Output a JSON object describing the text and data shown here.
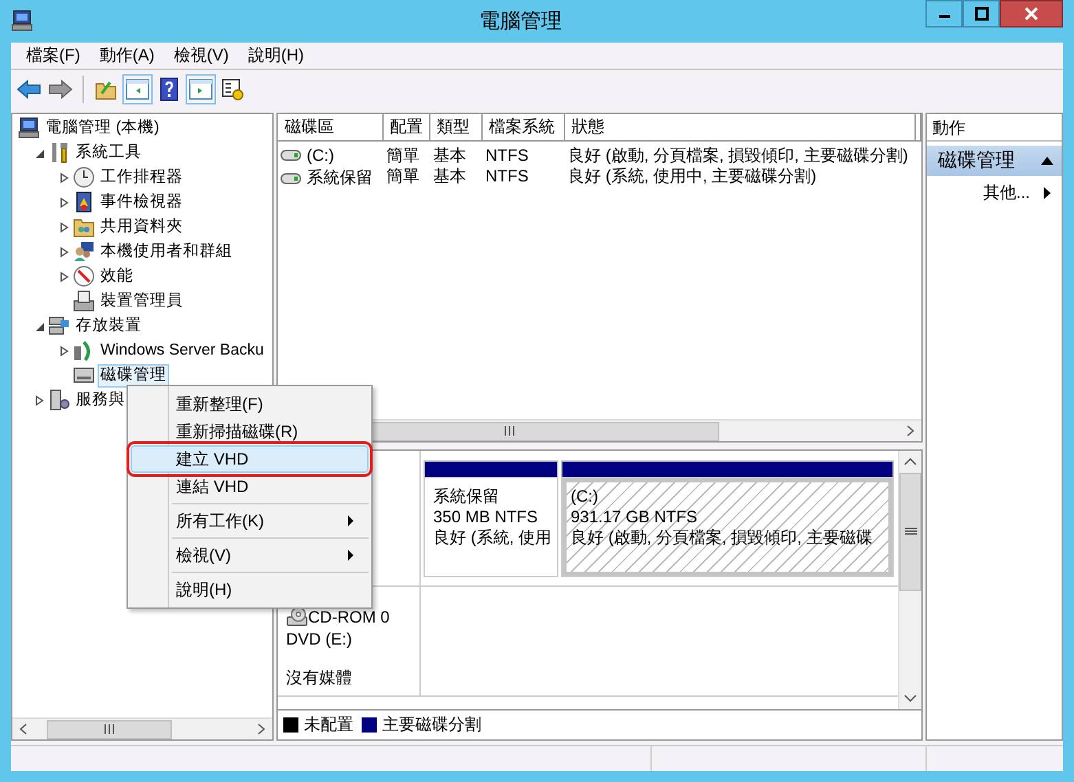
{
  "window": {
    "title": "電腦管理"
  },
  "menu_bar": [
    "檔案(F)",
    "動作(A)",
    "檢視(V)",
    "說明(H)"
  ],
  "tree": [
    {
      "label": "電腦管理 (本機)",
      "selected": false,
      "children": [
        {
          "label": "系統工具",
          "expanded": true,
          "selected": false,
          "children": [
            {
              "label": "工作排程器",
              "expanded": false,
              "selected": false
            },
            {
              "label": "事件檢視器",
              "expanded": false,
              "selected": false
            },
            {
              "label": "共用資料夾",
              "expanded": false,
              "selected": false
            },
            {
              "label": "本機使用者和群組",
              "expanded": false,
              "selected": false
            },
            {
              "label": "效能",
              "expanded": false,
              "selected": false
            },
            {
              "label": "裝置管理員",
              "selected": false
            }
          ]
        },
        {
          "label": "存放裝置",
          "expanded": true,
          "selected": false,
          "children": [
            {
              "label": "Windows Server Backu",
              "expanded": false,
              "selected": false
            },
            {
              "label": "磁碟管理",
              "selected": true
            }
          ]
        },
        {
          "label": "服務與",
          "expanded": false,
          "selected": false
        }
      ]
    }
  ],
  "volume_table": {
    "columns": [
      "磁碟區",
      "配置",
      "類型",
      "檔案系統",
      "狀態"
    ],
    "rows": [
      [
        "(C:)",
        "簡單",
        "基本",
        "NTFS",
        "良好 (啟動, 分頁檔案, 損毀傾印, 主要磁碟分割)"
      ],
      [
        "系統保留",
        "簡單",
        "基本",
        "NTFS",
        "良好 (系統, 使用中, 主要磁碟分割)"
      ]
    ]
  },
  "disk_map": {
    "disks": [
      {
        "partitions": [
          {
            "name": "系統保留",
            "size": "350 MB NTFS",
            "status": "良好 (系統, 使用",
            "selected": false
          },
          {
            "name": "(C:)",
            "size": "931.17 GB NTFS",
            "status": "良好 (啟動, 分頁檔案, 損毀傾印, 主要磁碟",
            "selected": true
          }
        ]
      },
      {
        "labels": [
          "CD-ROM 0",
          "DVD (E:)",
          "沒有媒體"
        ]
      }
    ],
    "legend": [
      {
        "label": "未配置",
        "color": "#000000"
      },
      {
        "label": "主要磁碟分割",
        "color": "#000080"
      }
    ]
  },
  "actions": {
    "title": "動作",
    "section": {
      "label": "磁碟管理",
      "expanded": true
    },
    "items": [
      "其他..."
    ]
  },
  "context_menu": [
    {
      "kind": "item",
      "label": "重新整理(F)",
      "selected": false
    },
    {
      "kind": "item",
      "label": "重新掃描磁碟(R)",
      "selected": false
    },
    {
      "kind": "item",
      "label": "建立 VHD",
      "selected": true,
      "annotated": true
    },
    {
      "kind": "item",
      "label": "連結 VHD",
      "selected": false
    },
    {
      "kind": "separator"
    },
    {
      "kind": "submenu",
      "label": "所有工作(K)",
      "selected": false
    },
    {
      "kind": "separator"
    },
    {
      "kind": "submenu",
      "label": "檢視(V)",
      "selected": false
    },
    {
      "kind": "separator"
    },
    {
      "kind": "item",
      "label": "說明(H)",
      "selected": false
    }
  ]
}
